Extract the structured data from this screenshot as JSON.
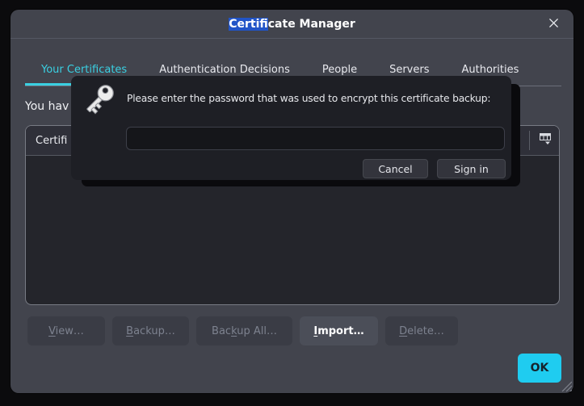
{
  "window": {
    "title": {
      "selected": "Certifi",
      "rest": "cate Manager"
    }
  },
  "tabs": [
    {
      "label": "Your Certificates",
      "active": true
    },
    {
      "label": "Authentication Decisions",
      "active": false
    },
    {
      "label": "People",
      "active": false
    },
    {
      "label": "Servers",
      "active": false
    },
    {
      "label": "Authorities",
      "active": false
    }
  ],
  "main": {
    "intro_text": "You hav",
    "list": {
      "header": "Certifi"
    }
  },
  "dialog": {
    "message": "Please enter the password that was used to encrypt this certificate backup:",
    "password_value": "",
    "cancel_label": "Cancel",
    "signin_label": "Sign in"
  },
  "actions": [
    {
      "pre": "",
      "key": "V",
      "post": "iew…",
      "enabled": false
    },
    {
      "pre": "",
      "key": "B",
      "post": "ackup…",
      "enabled": false
    },
    {
      "pre": "Bac",
      "key": "k",
      "post": "up All…",
      "enabled": false
    },
    {
      "pre": "",
      "key": "I",
      "post": "mport…",
      "enabled": true
    },
    {
      "pre": "",
      "key": "D",
      "post": "elete…",
      "enabled": false
    }
  ],
  "ok_label": "OK",
  "icons": [
    "close-icon",
    "key-icon",
    "column-picker-icon",
    "resize-grip-icon"
  ],
  "colors": {
    "accent_cyan": "#3ad0e2",
    "ok_button_cyan": "#1fccf0",
    "title_selection_blue": "#2154c7",
    "window_bg": "#42444d",
    "list_bg": "#24252b",
    "dialog_bg": "#1e1f25"
  }
}
